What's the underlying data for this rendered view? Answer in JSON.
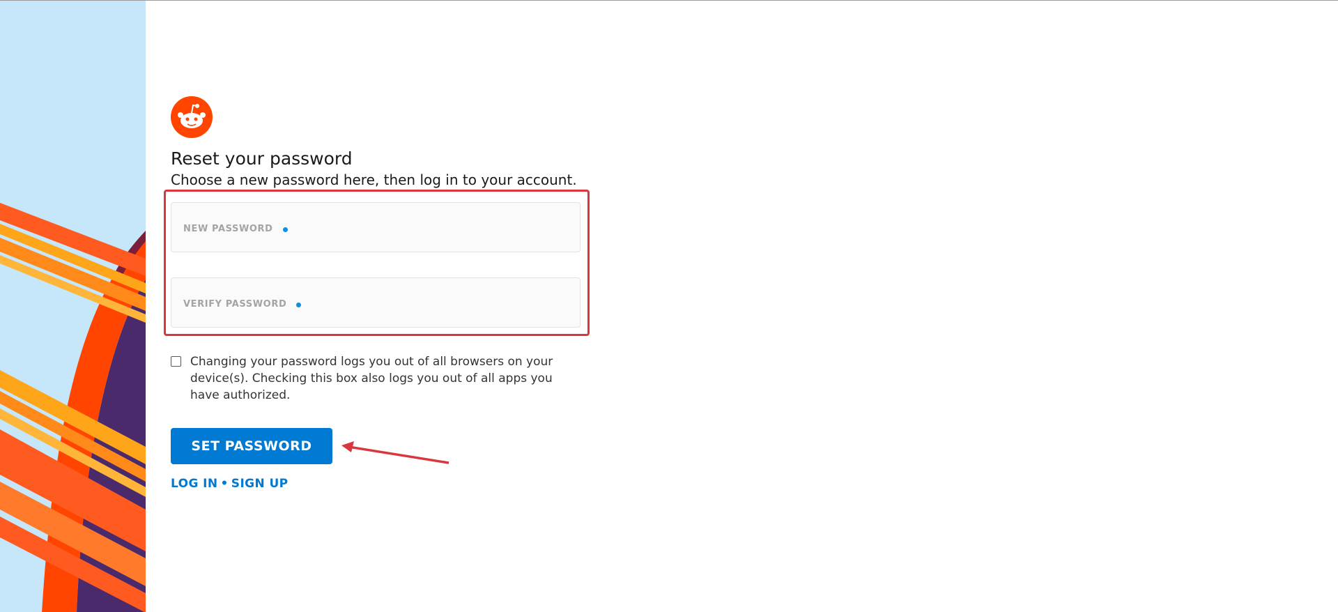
{
  "heading": {
    "title": "Reset your password",
    "subtitle": "Choose a new password here, then log in to your account."
  },
  "logo": {
    "icon": "reddit-alien-icon",
    "color": "#ff4500"
  },
  "form": {
    "new_password": {
      "label": "NEW PASSWORD",
      "value": ""
    },
    "verify_password": {
      "label": "VERIFY PASSWORD",
      "value": ""
    },
    "logout_checkbox": {
      "checked": false,
      "label": "Changing your password logs you out of all browsers on your device(s). Checking this box also logs you out of all apps you have authorized."
    },
    "submit_label": "SET PASSWORD"
  },
  "links": {
    "login": "LOG IN",
    "separator": "•",
    "signup": "SIGN UP"
  },
  "colors": {
    "accent": "#0079d3",
    "annotation": "#d9363e",
    "art_background": "#c6e6f9"
  }
}
